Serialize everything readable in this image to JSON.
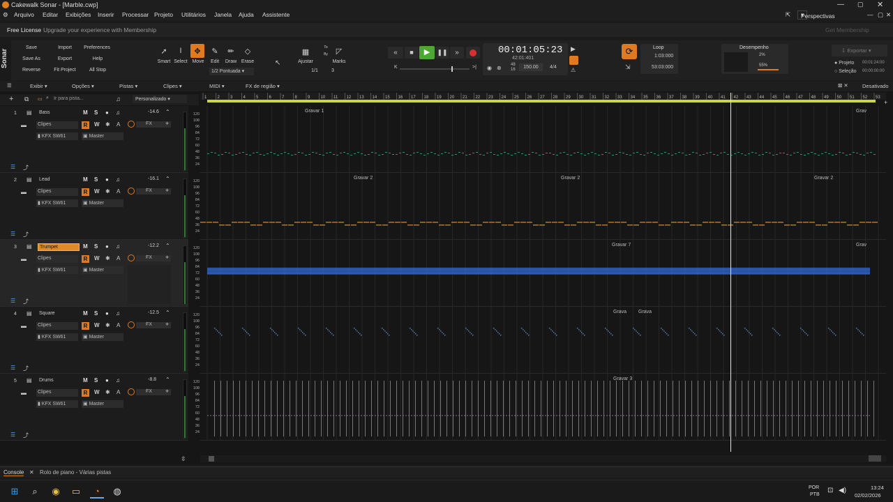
{
  "window": {
    "title": "Cakewalk Sonar - [Marble.cwp]"
  },
  "menu": [
    "Arquivo",
    "Editar",
    "Exibições",
    "Inserir",
    "Processar",
    "Projeto",
    "Utilitários",
    "Janela",
    "Ajuda",
    "Assistente"
  ],
  "license": {
    "label": "Free License",
    "upgrade": "Upgrade your experience with Membership",
    "get": "Get Membership",
    "perspectives": "Perspectivas"
  },
  "brand": "Sonar",
  "file_actions": [
    "Save",
    "Import",
    "Preferences",
    "Save As",
    "Export",
    "Help",
    "Reverse",
    "Fit Project",
    "All Stop"
  ],
  "tools": {
    "smart": "Smart",
    "select": "Select",
    "move": "Move",
    "edit": "Edit",
    "draw": "Draw",
    "erase": "Erase",
    "snap_value": "1/2 Pontuada"
  },
  "snap": {
    "ajustar": "Ajustar",
    "to": "To",
    "by": "By",
    "marks": "Marks",
    "ratio": "1/1",
    "count": "3"
  },
  "transport": {
    "time": "00:01:05:23",
    "mbt": "42:01:401",
    "field1": "48",
    "field1b": "16",
    "tempo": "150.00",
    "meter": "4/4"
  },
  "loop": {
    "label": "Loop",
    "start": "1:03:000",
    "end": "53:03:000"
  },
  "performance": {
    "label": "Desempenho",
    "cpu": "2%",
    "disk": "55%"
  },
  "export": {
    "label": "Exportar",
    "projeto": "Projeto",
    "selecao": "Seleção",
    "projeto_time": "00:01:24:00",
    "selecao_time": "00:00:00:00"
  },
  "views_bar": [
    "Exibir",
    "Opções",
    "Pistas",
    "Clipes",
    "MIDI",
    "FX de região"
  ],
  "views_right": "Desativado",
  "track_search": "Ir para pista...",
  "track_preset": "Personalizado",
  "ruler": [
    "1",
    "2",
    "3",
    "4",
    "5",
    "6",
    "7",
    "8",
    "9",
    "10",
    "11",
    "12",
    "13",
    "14",
    "15",
    "16",
    "17",
    "18",
    "19",
    "20",
    "21",
    "22",
    "23",
    "24",
    "25",
    "26",
    "27",
    "28",
    "29",
    "30",
    "31",
    "32",
    "33",
    "34",
    "35",
    "36",
    "37",
    "38",
    "39",
    "40",
    "41",
    "42",
    "43",
    "44",
    "45",
    "46",
    "47",
    "48",
    "49",
    "50",
    "51",
    "52",
    "53"
  ],
  "scale_labels": [
    "120",
    "108",
    "96",
    "84",
    "72",
    "60",
    "48",
    "36",
    "24"
  ],
  "tracks": [
    {
      "num": "1",
      "name": "Bass",
      "vol": "-14.6",
      "clips": "Clipes",
      "synth": "KFX SW61",
      "out": "Master",
      "fx": "FX",
      "markers": [
        "Gravar 1",
        "Grav"
      ],
      "color": "#3a8a7a"
    },
    {
      "num": "2",
      "name": "Lead",
      "vol": "-16.1",
      "clips": "Clipes",
      "synth": "KFX SW61",
      "out": "Master",
      "fx": "FX",
      "markers": [
        "Gravar 2",
        "Gravar 2",
        "Gravar 2"
      ],
      "color": "#a8783a"
    },
    {
      "num": "3",
      "name": "Trumpet",
      "vol": "-12.2",
      "clips": "Clipes",
      "synth": "KFX SW61",
      "out": "Master",
      "fx": "FX",
      "markers": [
        "Gravar 7",
        "Grav"
      ],
      "color": "#3a6ab8"
    },
    {
      "num": "4",
      "name": "Square",
      "vol": "-12.5",
      "clips": "Clipes",
      "synth": "KFX SW61",
      "out": "Master",
      "fx": "FX",
      "markers": [
        "Grava",
        "Grava"
      ],
      "color": "#5a7ab0"
    },
    {
      "num": "5",
      "name": "Drums",
      "vol": "-8.8",
      "clips": "Clipes",
      "synth": "KFX SW61",
      "out": "Master",
      "fx": "FX",
      "markers": [
        "Gravar 3"
      ],
      "color": "#9a6a9a"
    }
  ],
  "track_buttons": {
    "m": "M",
    "s": "S",
    "r": "R",
    "w": "W"
  },
  "statusbar": {
    "console": "Console",
    "piano": "Rolo de piano - Várias pistas"
  },
  "taskbar": {
    "lang1": "POR",
    "lang2": "PTB",
    "time": "13:24",
    "date": "02/02/2026"
  }
}
